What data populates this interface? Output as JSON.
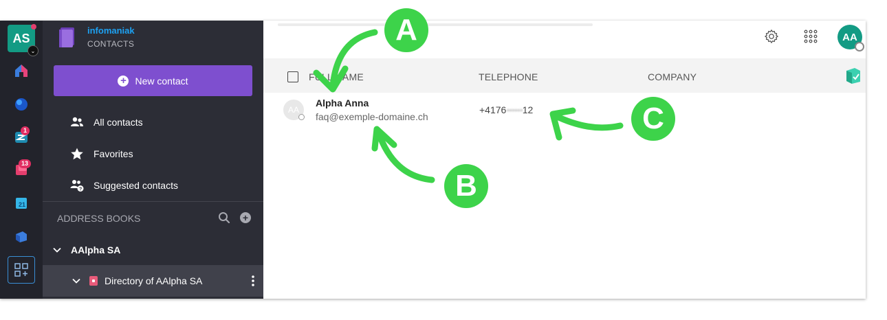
{
  "rail": {
    "user_initials": "AS",
    "badges": [
      "1",
      "13"
    ]
  },
  "brand": {
    "name": "infomaniak",
    "subtitle": "CONTACTS"
  },
  "sidebar": {
    "new_contact_label": "New contact",
    "items": [
      {
        "label": "All contacts",
        "icon": "people-icon"
      },
      {
        "label": "Favorites",
        "icon": "star-icon"
      },
      {
        "label": "Suggested contacts",
        "icon": "suggested-people-icon"
      }
    ],
    "address_books_label": "ADDRESS BOOKS",
    "group_label": "AAlpha SA",
    "directory_label": "Directory of AAlpha SA"
  },
  "header": {
    "user_initials": "AA"
  },
  "table": {
    "columns": [
      "FULL NAME",
      "TELEPHONE",
      "COMPANY"
    ],
    "rows": [
      {
        "initials": "AA",
        "name": "Alpha Anna",
        "email": "faq@exemple-domaine.ch",
        "phone_prefix": "+4176",
        "phone_hidden": "••••••",
        "phone_suffix": "12"
      }
    ]
  },
  "annotations": [
    "A",
    "B",
    "C"
  ],
  "colors": {
    "accent": "#7e4fcf",
    "teal": "#139b84",
    "annotation_green": "#3dd34a",
    "brand_blue": "#1da1f2"
  }
}
